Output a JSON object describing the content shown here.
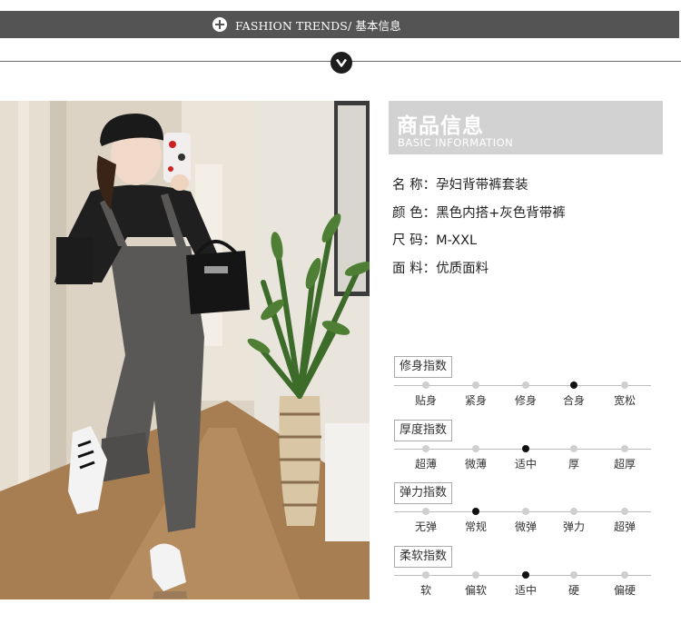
{
  "banner": {
    "text": "FASHION TRENDS/ 基本信息"
  },
  "info": {
    "title": "商品信息",
    "subtitle": "BASIC INFORMATION",
    "specs": [
      {
        "text": "名 称：孕妇背带裤套装"
      },
      {
        "text": "颜 色：黑色内搭+灰色背带裤"
      },
      {
        "text": "尺 码：M-XXL"
      },
      {
        "text": "面 料：优质面料"
      }
    ]
  },
  "scales": [
    {
      "label": "修身指数",
      "options": [
        "贴身",
        "紧身",
        "修身",
        "合身",
        "宽松"
      ],
      "selected": 3
    },
    {
      "label": "厚度指数",
      "options": [
        "超薄",
        "微薄",
        "适中",
        "厚",
        "超厚"
      ],
      "selected": 2
    },
    {
      "label": "弹力指数",
      "options": [
        "无弹",
        "常规",
        "微弹",
        "弹力",
        "超弹"
      ],
      "selected": 1
    },
    {
      "label": "柔软指数",
      "options": [
        "软",
        "偏软",
        "适中",
        "硬",
        "偏硬"
      ],
      "selected": 2
    }
  ]
}
